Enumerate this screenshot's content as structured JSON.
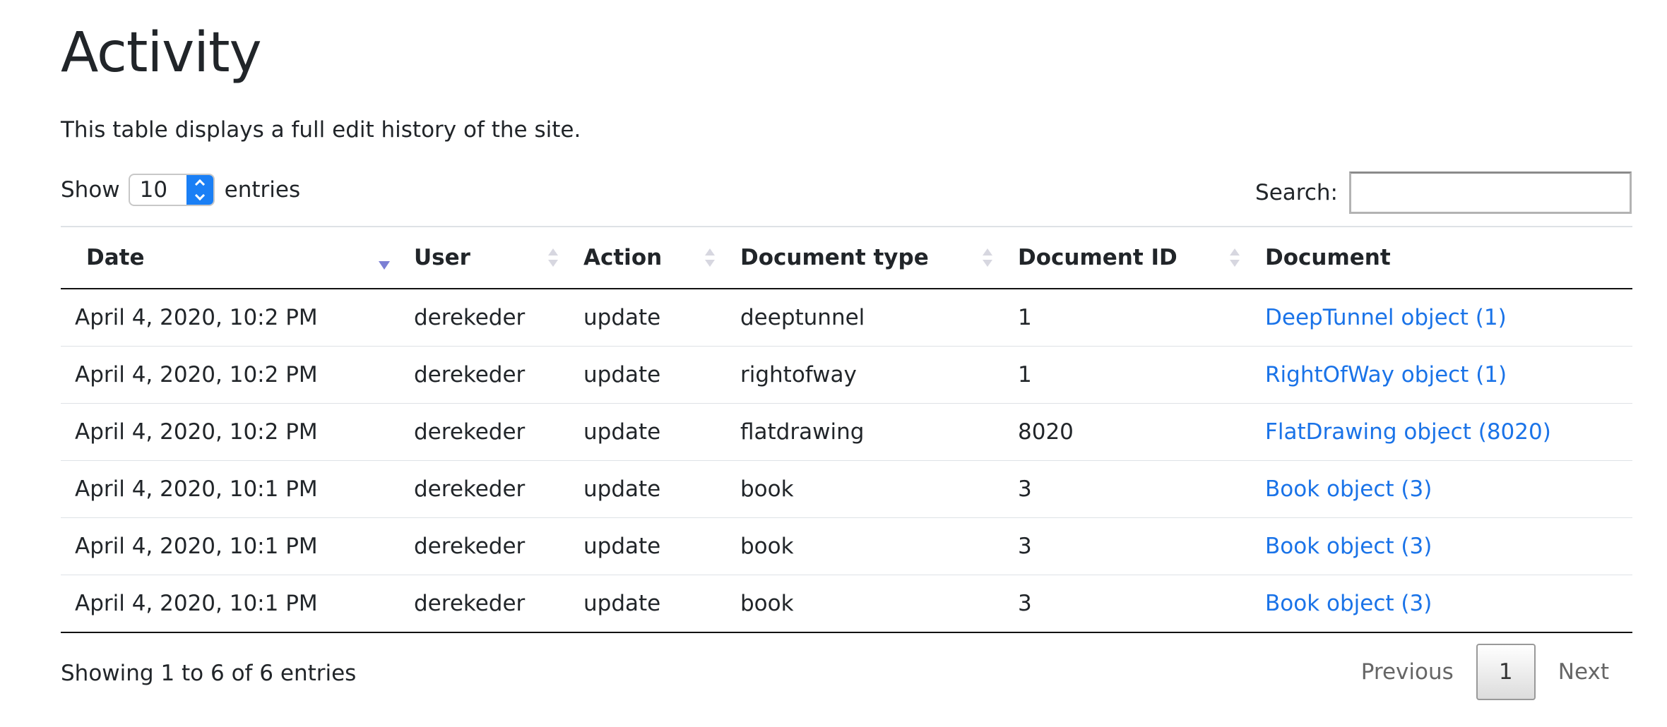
{
  "page": {
    "title": "Activity",
    "description": "This table displays a full edit history of the site."
  },
  "length_control": {
    "prefix": "Show",
    "value": "10",
    "suffix": "entries"
  },
  "search": {
    "label": "Search:",
    "value": "",
    "placeholder": ""
  },
  "table": {
    "columns": [
      "Date",
      "User",
      "Action",
      "Document type",
      "Document ID",
      "Document"
    ],
    "sorted_column": "Date",
    "sort_direction": "descending",
    "rows": [
      {
        "date": "April 4, 2020, 10:2 PM",
        "user": "derekeder",
        "action": "update",
        "doc_type": "deeptunnel",
        "doc_id": "1",
        "document": "DeepTunnel object (1)"
      },
      {
        "date": "April 4, 2020, 10:2 PM",
        "user": "derekeder",
        "action": "update",
        "doc_type": "rightofway",
        "doc_id": "1",
        "document": "RightOfWay object (1)"
      },
      {
        "date": "April 4, 2020, 10:2 PM",
        "user": "derekeder",
        "action": "update",
        "doc_type": "flatdrawing",
        "doc_id": "8020",
        "document": "FlatDrawing object (8020)"
      },
      {
        "date": "April 4, 2020, 10:1 PM",
        "user": "derekeder",
        "action": "update",
        "doc_type": "book",
        "doc_id": "3",
        "document": "Book object (3)"
      },
      {
        "date": "April 4, 2020, 10:1 PM",
        "user": "derekeder",
        "action": "update",
        "doc_type": "book",
        "doc_id": "3",
        "document": "Book object (3)"
      },
      {
        "date": "April 4, 2020, 10:1 PM",
        "user": "derekeder",
        "action": "update",
        "doc_type": "book",
        "doc_id": "3",
        "document": "Book object (3)"
      }
    ]
  },
  "footer": {
    "info": "Showing 1 to 6 of 6 entries",
    "previous_label": "Previous",
    "current_page": "1",
    "next_label": "Next"
  },
  "colors": {
    "link": "#1a73e8",
    "select_accent": "#1a7ff5",
    "sort_active": "#7b7fd4"
  }
}
